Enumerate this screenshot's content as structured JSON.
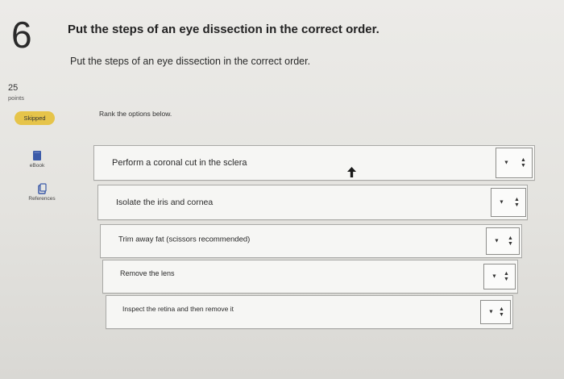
{
  "question": {
    "number": "6",
    "title": "Put the steps of an eye dissection in the correct order.",
    "prompt": "Put the steps of an eye dissection in the correct order."
  },
  "sidebar": {
    "points_value": "25",
    "points_label": "points",
    "status": "Skipped",
    "ebook_label": "eBook",
    "references_label": "References"
  },
  "rank": {
    "instruction": "Rank the options below.",
    "options": [
      {
        "label": "Perform a coronal cut in the sclera"
      },
      {
        "label": "Isolate the iris and cornea"
      },
      {
        "label": "Trim away fat (scissors recommended)"
      },
      {
        "label": "Remove the lens"
      },
      {
        "label": "Inspect the retina and then remove it"
      }
    ],
    "select_caret": "▼",
    "select_stepper": "▲▼"
  },
  "colors": {
    "badge": "#e6c44a",
    "ebook_icon": "#3b5aa8",
    "references_icon": "#3b5aa8"
  }
}
